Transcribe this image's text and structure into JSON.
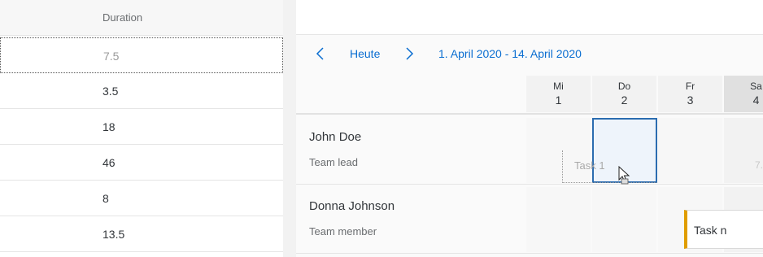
{
  "table": {
    "column_header": "Duration",
    "rows": [
      "7.5",
      "3.5",
      "18",
      "46",
      "8",
      "13.5"
    ]
  },
  "calendar": {
    "today_label": "Heute",
    "date_range": "1. April 2020 - 14. April 2020",
    "days": [
      {
        "name": "Mi",
        "date": "1",
        "weekend": false
      },
      {
        "name": "Do",
        "date": "2",
        "weekend": false
      },
      {
        "name": "Fr",
        "date": "3",
        "weekend": false
      },
      {
        "name": "Sa",
        "date": "4",
        "weekend": true
      }
    ],
    "people": [
      {
        "name": "John Doe",
        "role": "Team lead"
      },
      {
        "name": "Donna Johnson",
        "role": "Team member"
      }
    ],
    "ghost_task_label": "Task 1",
    "ghost_weekend_label": "7.",
    "task_n_label": "Task n",
    "colors": {
      "accent": "#0a6ed1",
      "task_n_border": "#e09d00",
      "selection": "#2b6cb0"
    }
  }
}
